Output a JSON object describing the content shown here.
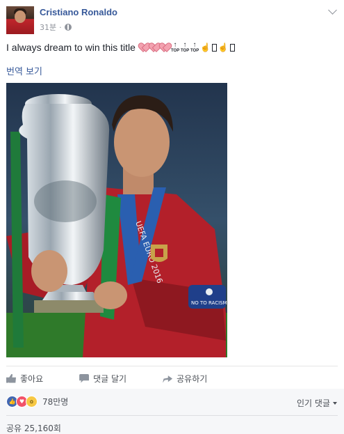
{
  "post": {
    "author": "Cristiano Ronaldo",
    "time": "31분",
    "separator": "·",
    "text": "I always dream to win this title",
    "emoji_icons": [
      "heart-icon",
      "heart-icon",
      "heart-icon",
      "top-arrow-icon",
      "top-arrow-icon",
      "top-arrow-icon",
      "pointing-hand-icon",
      "missing-glyph",
      "pointing-hand-icon",
      "missing-glyph"
    ],
    "top_label": "TOP",
    "translate_label": "번역 보기"
  },
  "photo": {
    "jersey_text": "UEFA EURO 2016",
    "armband_text": "NO TO RACISM"
  },
  "actions": {
    "like": "좋아요",
    "comment": "댓글 달기",
    "share": "공유하기"
  },
  "reactions": {
    "count": "78만명",
    "types": [
      "like",
      "love",
      "wow"
    ]
  },
  "comments_sort": "인기 댓글",
  "shares": "공유 25,160회",
  "colors": {
    "link": "#365899",
    "text": "#1d2129",
    "muted": "#90949c",
    "like": "#4267b2",
    "love": "#f25268",
    "wow": "#f7c844",
    "jersey": "#b3202a"
  }
}
